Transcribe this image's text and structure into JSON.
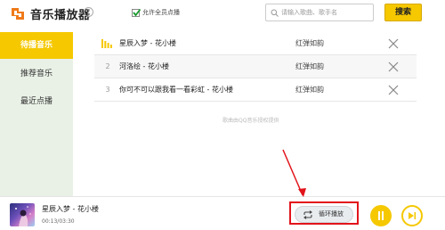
{
  "header": {
    "app_title": "音乐播放器",
    "help_icon": "?",
    "allow_label": "允许全员点播",
    "allow_checked": true,
    "search_placeholder": "请输入歌曲、歌手名",
    "search_value": "",
    "search_button": "搜索"
  },
  "sidebar": {
    "items": [
      {
        "label": "待播音乐",
        "active": true
      },
      {
        "label": "推荐音乐",
        "active": false
      },
      {
        "label": "最近点播",
        "active": false
      }
    ]
  },
  "songs": [
    {
      "index": "",
      "playing": true,
      "title": "星辰入梦 - 花小楼",
      "artist": "红弹如韵"
    },
    {
      "index": "2",
      "playing": false,
      "title": "河洛绘 - 花小楼",
      "artist": "红弹如韵"
    },
    {
      "index": "3",
      "playing": false,
      "title": "你可不可以跟我看一看彩虹 - 花小楼",
      "artist": "红弹如韵"
    }
  ],
  "source_note": "歌曲由QQ音乐授权提供",
  "player": {
    "title": "星辰入梦 - 花小楼",
    "time": "00:13/03:30",
    "loop_label": "循环播放",
    "state": "playing"
  },
  "colors": {
    "accent": "#f5c800",
    "sidebar_bg": "#e9f1e6",
    "annotation": "#e2141b"
  },
  "icons": {
    "logo": "music-logo-icon",
    "search": "search-icon",
    "playing": "equalizer-icon",
    "delete": "close-icon",
    "loop": "loop-icon",
    "pause": "pause-icon",
    "next": "next-icon"
  }
}
